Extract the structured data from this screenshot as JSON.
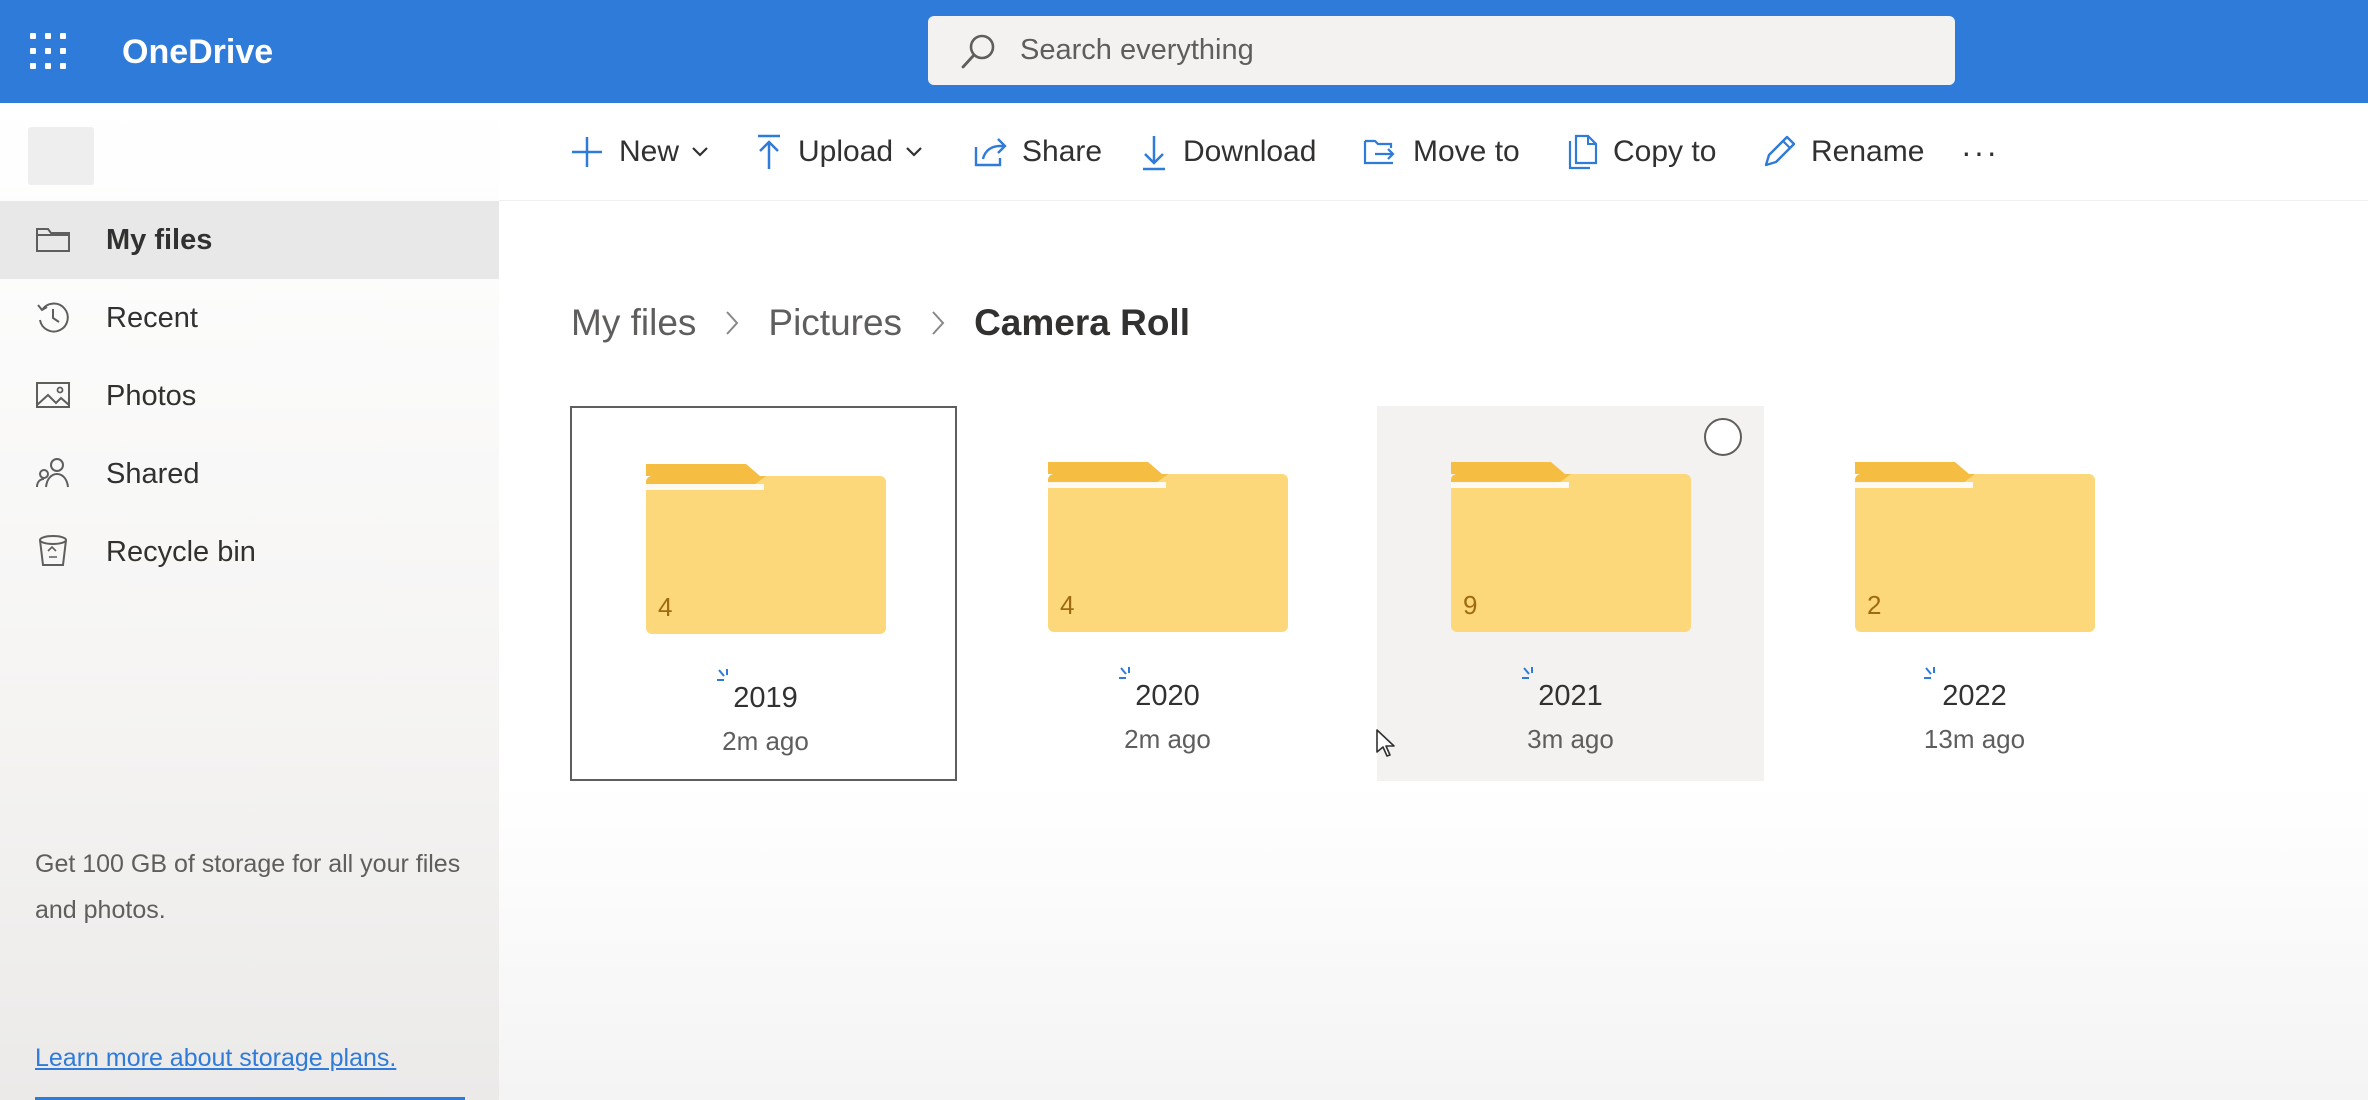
{
  "app": {
    "title": "OneDrive",
    "brand_color": "#2f7bd9"
  },
  "search": {
    "placeholder": "Search everything",
    "value": ""
  },
  "sidebar": {
    "items": [
      {
        "label": "My files",
        "icon": "folder-icon",
        "selected": true
      },
      {
        "label": "Recent",
        "icon": "history-icon",
        "selected": false
      },
      {
        "label": "Photos",
        "icon": "photo-icon",
        "selected": false
      },
      {
        "label": "Shared",
        "icon": "shared-people-icon",
        "selected": false
      },
      {
        "label": "Recycle bin",
        "icon": "recycle-bin-icon",
        "selected": false
      }
    ],
    "promo_text": "Get 100 GB of storage for all your files and photos.",
    "promo_link": "Learn more about storage plans."
  },
  "toolbar": {
    "new_label": "New",
    "upload_label": "Upload",
    "share_label": "Share",
    "download_label": "Download",
    "move_label": "Move to",
    "copy_label": "Copy to",
    "rename_label": "Rename",
    "more_label": "···"
  },
  "breadcrumb": {
    "items": [
      "My files",
      "Pictures",
      "Camera Roll"
    ]
  },
  "folders": [
    {
      "name": "2019",
      "count": "4",
      "modified": "2m ago",
      "state": "selected"
    },
    {
      "name": "2020",
      "count": "4",
      "modified": "2m ago",
      "state": "normal"
    },
    {
      "name": "2021",
      "count": "9",
      "modified": "3m ago",
      "state": "hovered"
    },
    {
      "name": "2022",
      "count": "2",
      "modified": "13m ago",
      "state": "normal"
    }
  ],
  "colors": {
    "folder_front": "#fcd87a",
    "folder_back": "#f5bd42",
    "sync_icon": "#2f7bd9"
  }
}
